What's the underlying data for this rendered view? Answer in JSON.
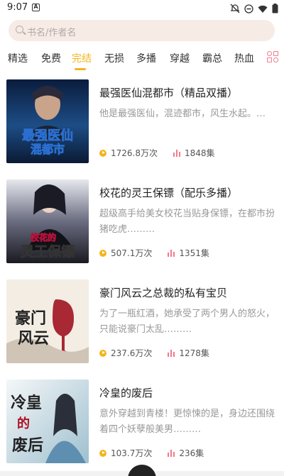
{
  "status": {
    "time": "9:07",
    "a_icon_label": "A"
  },
  "search": {
    "placeholder": "书名/作者名"
  },
  "tabs": [
    {
      "label": "精选"
    },
    {
      "label": "免费"
    },
    {
      "label": "完结",
      "active": true
    },
    {
      "label": "无损"
    },
    {
      "label": "多播"
    },
    {
      "label": "穿越"
    },
    {
      "label": "霸总"
    },
    {
      "label": "热血"
    }
  ],
  "books": [
    {
      "title": "最强医仙混都市（精品双播）",
      "description": "他是最强医仙，混迹都市，风生水起。…",
      "plays": "1726.8万次",
      "episodes": "1848集",
      "cover": {
        "top_text": "",
        "main_text": "最强医仙混都市",
        "colors": [
          "#0d2a55",
          "#3f6ea8"
        ]
      }
    },
    {
      "title": "校花的灵王保镖（配乐多播）",
      "description": "超级高手给美女校花当贴身保镖，在都市扮猪吃虎………",
      "plays": "507.1万次",
      "episodes": "1351集",
      "cover": {
        "top_text": "校花的",
        "main_text": "灵王保镖",
        "colors": [
          "#1a1a2e",
          "#5a5a7a"
        ]
      }
    },
    {
      "title": "豪门风云之总裁的私有宝贝",
      "description": "为了一瓶红酒，她承受了两个男人的怒火，只能说豪门太乱………",
      "plays": "237.6万次",
      "episodes": "1278集",
      "cover": {
        "top_text": "",
        "main_text": "豪门风云",
        "colors": [
          "#f4eee6",
          "#a01020"
        ]
      }
    },
    {
      "title": "冷皇的废后",
      "description": "意外穿越到青楼！更惊悚的是，身边还围绕着四个妖孽般美男………",
      "plays": "103.7万次",
      "episodes": "236集",
      "cover": {
        "top_text": "",
        "main_text": "冷皇的废后",
        "colors": [
          "#e8f0f4",
          "#8ab0c4"
        ]
      }
    }
  ],
  "colors": {
    "accent": "#f3b51c",
    "pink": "#f07a8c",
    "search_bg": "#f7ebe6"
  }
}
